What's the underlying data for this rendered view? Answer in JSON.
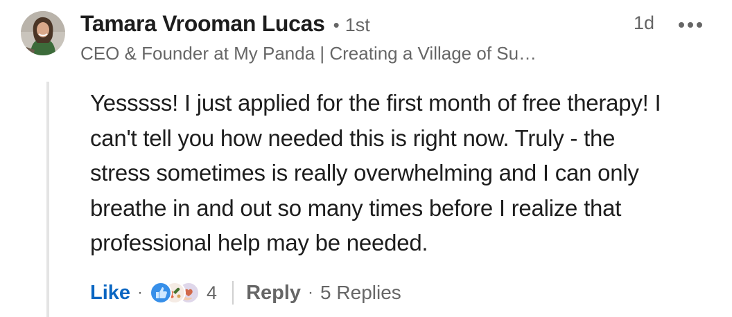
{
  "comment": {
    "author": {
      "name": "Tamara Vrooman Lucas",
      "connection_separator": "•",
      "connection_degree": "1st",
      "headline": "CEO & Founder at My Panda | Creating a Village of Su…"
    },
    "timestamp": "1d",
    "more_icon": "more-horizontal-icon",
    "body_lines": [
      "Yesssss! I just applied for the first month of free therapy! I",
      "can't tell you how needed this is right now. Truly - the",
      "stress sometimes is really overwhelming and I can only",
      "breathe in and out so many times before I realize that",
      "professional help may be needed."
    ],
    "actions": {
      "like_label": "Like",
      "separator": "·",
      "reaction_icons": [
        "like-icon",
        "celebrate-icon",
        "support-icon"
      ],
      "reaction_count": "4",
      "reply_label": "Reply",
      "replies_label": "5 Replies"
    }
  },
  "colors": {
    "like_blue": "#0a66c2",
    "secondary_text": "#666666",
    "primary_text": "#1d1d1d",
    "thread_line": "#e4e4e4"
  }
}
